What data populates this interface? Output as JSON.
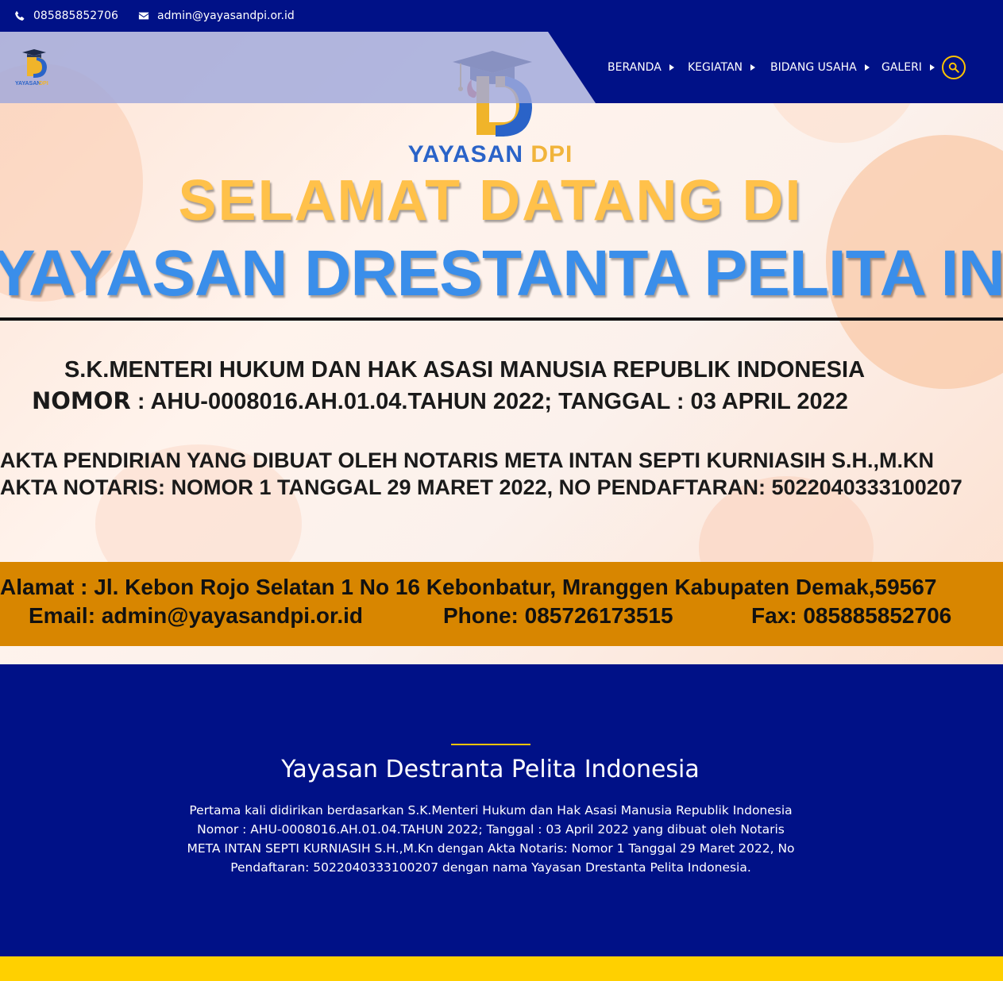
{
  "topbar": {
    "phone": "085885852706",
    "email": "admin@yayasandpi.or.id"
  },
  "logo": {
    "text_a": "YAYASAN",
    "text_b": "DPI"
  },
  "nav": {
    "items": [
      {
        "label": "BERANDA"
      },
      {
        "label": "KEGIATAN"
      },
      {
        "label": "BIDANG USAHA"
      },
      {
        "label": "GALERI"
      }
    ],
    "search_icon": "search-icon"
  },
  "hero": {
    "brand_a": "YAYASAN",
    "brand_b": "DPI",
    "welcome": "SELAMAT DATANG DI",
    "org_name": "YAYASAN DRESTANTA PELITA INDONESIA",
    "sk_line1": "S.K.MENTERI HUKUM DAN HAK ASASI MANUSIA REPUBLIK INDONESIA",
    "sk_nomor_label": "NOMOR",
    "sk_line2_rest": " : AHU-0008016.AH.01.04.TAHUN 2022; TANGGAL : 03 APRIL 2022",
    "akta_line1": "AKTA PENDIRIAN YANG DIBUAT OLEH NOTARIS META INTAN SEPTI KURNIASIH S.H.,M.KN",
    "akta_line2": "AKTA NOTARIS: NOMOR 1 TANGGAL 29 MARET 2022, NO PENDAFTARAN: 5022040333100207",
    "address": "Alamat : Jl. Kebon Rojo Selatan 1  No 16 Kebonbatur, Mranggen Kabupaten Demak,59567",
    "email": "Email: admin@yayasandpi.or.id",
    "phone": "Phone: 085726173515",
    "fax": "Fax: 085885852706"
  },
  "about": {
    "title": "Yayasan Destranta Pelita Indonesia",
    "text": "Pertama kali didirikan berdasarkan S.K.Menteri Hukum dan Hak Asasi Manusia Republik Indonesia Nomor : AHU-0008016.AH.01.04.TAHUN 2022; Tanggal : 03 April 2022 yang dibuat oleh Notaris META INTAN SEPTI KURNIASIH S.H.,M.Kn dengan Akta Notaris: Nomor 1 Tanggal 29 Maret 2022, No Pendaftaran: 5022040333100207 dengan nama Yayasan Drestanta Pelita Indonesia."
  },
  "colors": {
    "navy": "#001187",
    "accent_yellow": "#ffc400",
    "footer_yellow": "#ffd000",
    "banner_orange": "#d88600"
  }
}
